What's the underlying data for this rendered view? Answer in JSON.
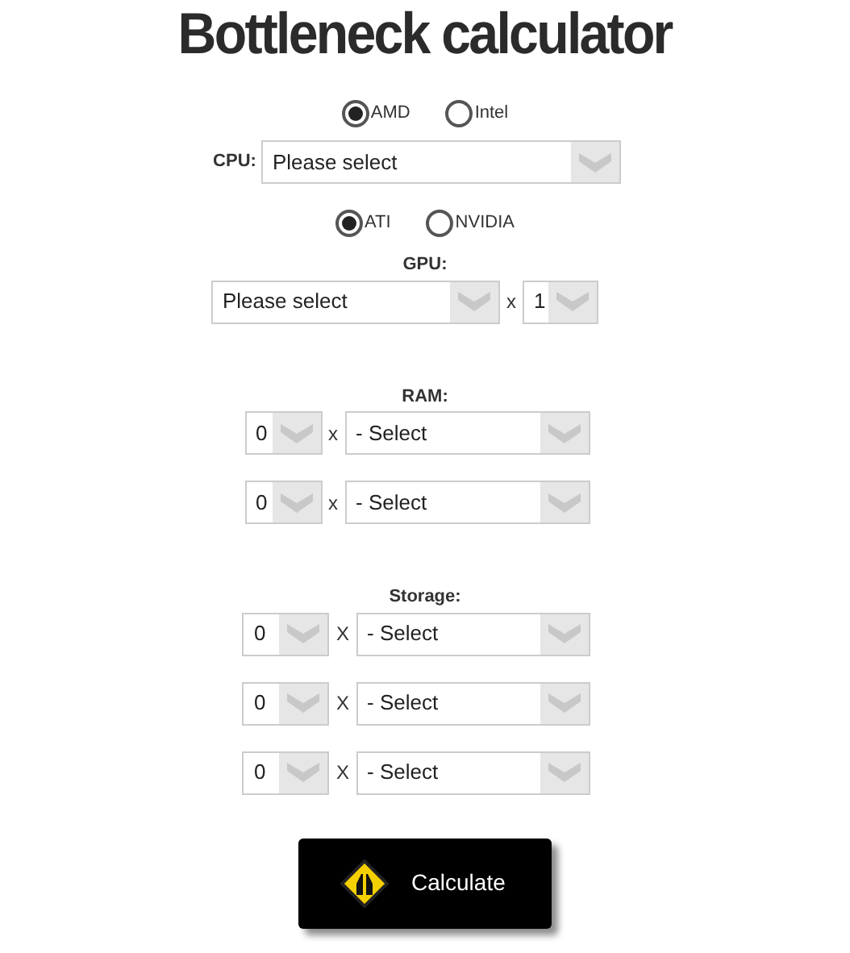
{
  "title": "Bottleneck calculator",
  "cpu_brand": [
    {
      "label": "AMD",
      "selected": true
    },
    {
      "label": "Intel",
      "selected": false
    }
  ],
  "cpu": {
    "label": "CPU:",
    "value": "Please select"
  },
  "gpu_brand": [
    {
      "label": "ATI",
      "selected": true
    },
    {
      "label": "NVIDIA",
      "selected": false
    }
  ],
  "gpu": {
    "label": "GPU:",
    "value": "Please select",
    "multiplier": "x",
    "quantity": "1"
  },
  "ram": {
    "label": "RAM:",
    "rows": [
      {
        "quantity": "0",
        "multiplier": "x",
        "value": "- Select"
      },
      {
        "quantity": "0",
        "multiplier": "x",
        "value": "- Select"
      }
    ]
  },
  "storage": {
    "label": "Storage:",
    "rows": [
      {
        "quantity": "0",
        "multiplier": "X",
        "value": "- Select"
      },
      {
        "quantity": "0",
        "multiplier": "X",
        "value": "- Select"
      },
      {
        "quantity": "0",
        "multiplier": "X",
        "value": "- Select"
      }
    ]
  },
  "button": {
    "label": "Calculate"
  }
}
